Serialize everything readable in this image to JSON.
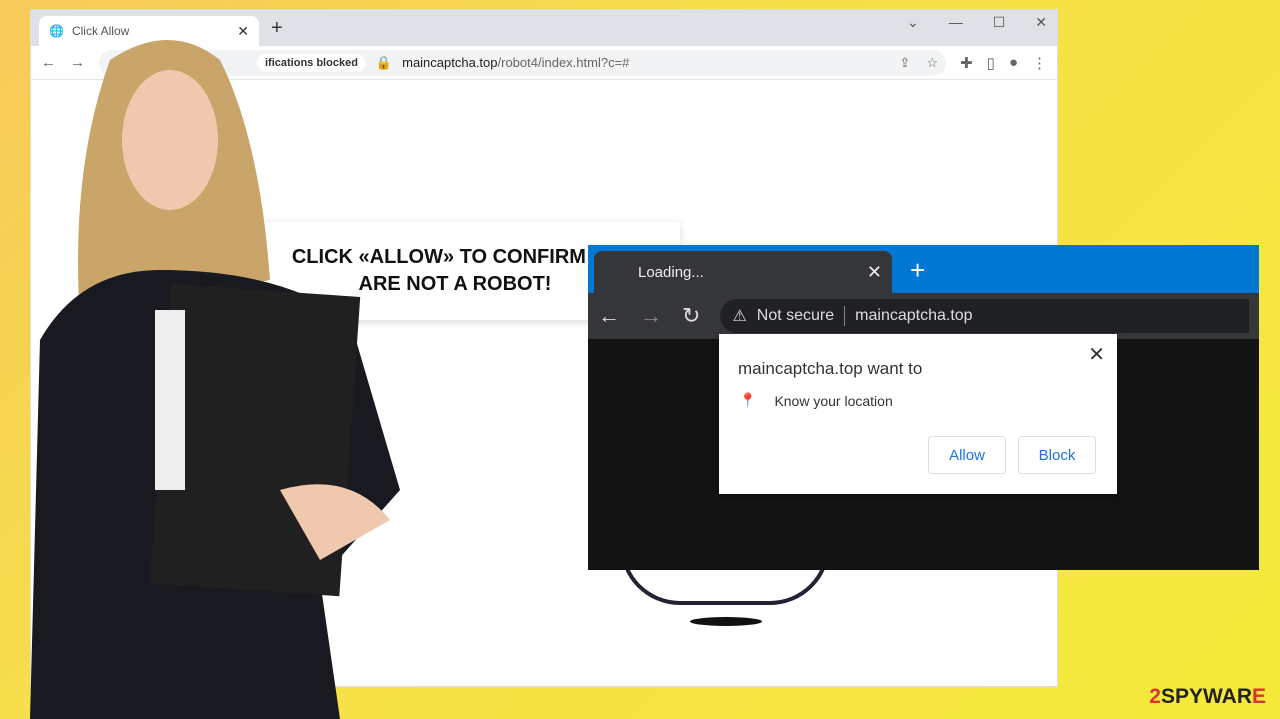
{
  "back_browser": {
    "tab_title": "Click Allow",
    "new_tab": "+",
    "chip": "Notifications blocked",
    "chip_visible": "ifications blocked",
    "url_host": "maincaptcha.top",
    "url_path": "/robot4/index.html?c=#",
    "message_line1": "CLICK «ALLOW» TO CONFIRM THAT YOU",
    "message_visible1": "CLICK «ALLOW» TO CONFIRM TH",
    "message_line2": "ARE NOT A ROBOT!"
  },
  "front_browser": {
    "tab_title": "Loading...",
    "new_tab": "+",
    "security": "Not secure",
    "url": "maincaptcha.top",
    "accent": "#0078d4"
  },
  "popup": {
    "title": "maincaptcha.top want to",
    "permission": "Know your location",
    "allow": "Allow",
    "block": "Block",
    "icon": "location-pin-icon"
  },
  "logo": {
    "prefix": "2",
    "text": "SPYWAR",
    "suffix": "E"
  }
}
